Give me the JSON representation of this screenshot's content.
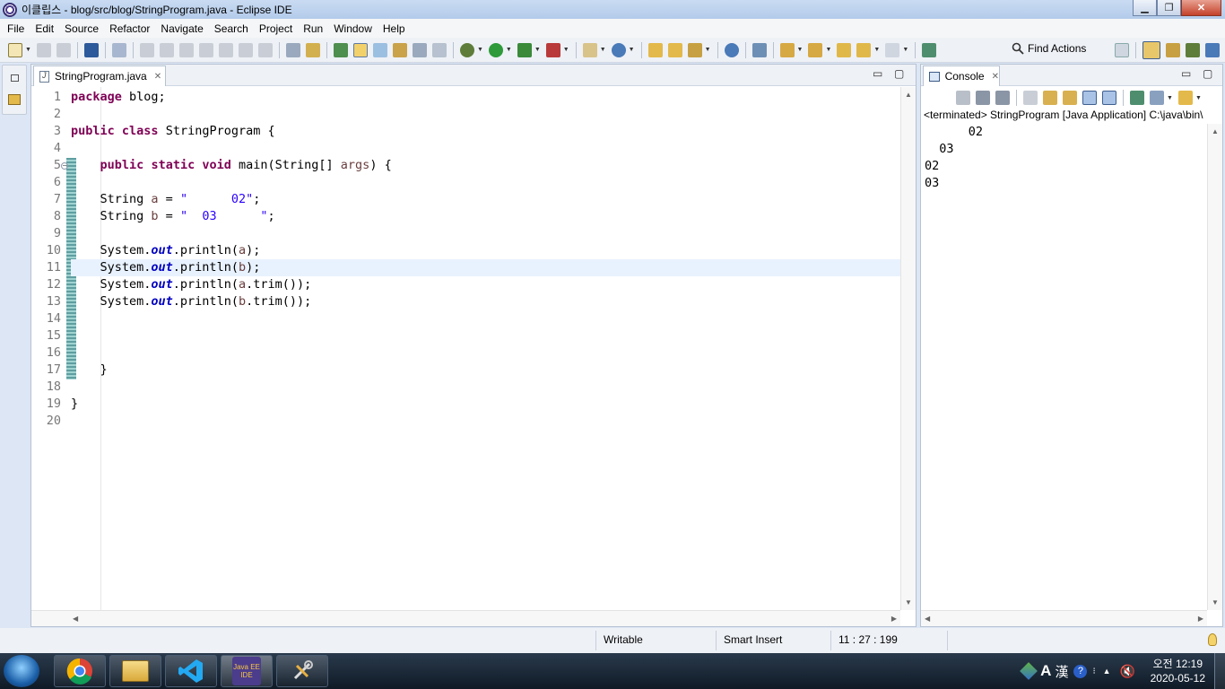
{
  "window": {
    "title": "이클립스 - blog/src/blog/StringProgram.java - Eclipse IDE"
  },
  "menu": [
    "File",
    "Edit",
    "Source",
    "Refactor",
    "Navigate",
    "Search",
    "Project",
    "Run",
    "Window",
    "Help"
  ],
  "toolbar": {
    "find_actions": "Find Actions"
  },
  "editor": {
    "tab_label": "StringProgram.java",
    "current_line": 11,
    "lines": [
      "1",
      "2",
      "3",
      "4",
      "5",
      "6",
      "7",
      "8",
      "9",
      "10",
      "11",
      "12",
      "13",
      "14",
      "15",
      "16",
      "17",
      "18",
      "19",
      "20"
    ],
    "code": {
      "l1_kw": "package",
      "l1_rest": " blog;",
      "l3_kw1": "public",
      "l3_kw2": "class",
      "l3_rest": " StringProgram {",
      "l5_kw1": "public",
      "l5_kw2": "static",
      "l5_kw3": "void",
      "l5_a": " main(String[] ",
      "l5_var": "args",
      "l5_b": ") {",
      "l7_a": "    String ",
      "l7_var": "a",
      "l7_b": " = ",
      "l7_str": "\"      02\"",
      "l7_c": ";",
      "l8_a": "    String ",
      "l8_var": "b",
      "l8_b": " = ",
      "l8_str": "\"  03      \"",
      "l8_c": ";",
      "l10_a": "    System.",
      "l10_fld": "out",
      "l10_b": ".println(",
      "l10_var": "a",
      "l10_c": ");",
      "l11_a": "    System.",
      "l11_fld": "out",
      "l11_b": ".println(",
      "l11_var": "b",
      "l11_c": ");",
      "l12_a": "    System.",
      "l12_fld": "out",
      "l12_b": ".println(",
      "l12_var": "a",
      "l12_c": ".trim());",
      "l13_a": "    System.",
      "l13_fld": "out",
      "l13_b": ".println(",
      "l13_var": "b",
      "l13_c": ".trim());",
      "l17": "    }",
      "l19": "}"
    }
  },
  "console": {
    "tab_label": "Console",
    "status": "<terminated> StringProgram [Java Application] C:\\java\\bin\\",
    "output": [
      "      02",
      "  03",
      "02",
      "03"
    ]
  },
  "statusbar": {
    "writable": "Writable",
    "insert_mode": "Smart Insert",
    "position": "11 : 27 : 199"
  },
  "taskbar": {
    "apps": [
      "chrome-icon",
      "explorer-icon",
      "vscode-icon",
      "eclipse-icon",
      "tools-icon"
    ],
    "eclipse_label": "Java EE IDE",
    "ime_lang": "A",
    "ime_hanja": "漢",
    "clock_time": "오전 12:19",
    "clock_date": "2020-05-12"
  },
  "colors": {
    "keyword": "#7f0055",
    "string": "#2a00ff",
    "field": "#0000c0",
    "variable": "#6a3e3e"
  }
}
